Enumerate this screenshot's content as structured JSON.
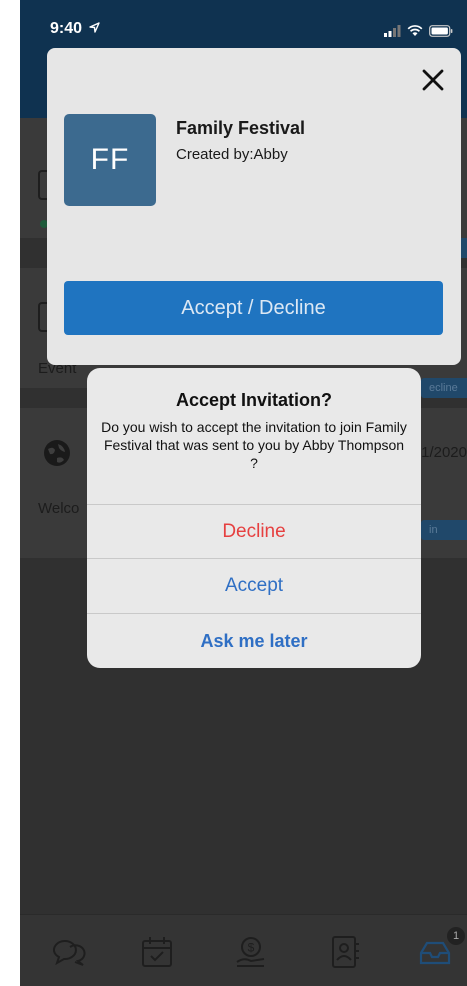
{
  "status_bar": {
    "time": "9:40"
  },
  "background": {
    "row_label_1": "Event",
    "row_label_2": "Welco",
    "row_date": "1/2020",
    "pill_1": "ecline",
    "pill_2": "in"
  },
  "tab_bar": {
    "badge": "1"
  },
  "invite_card": {
    "avatar_initials": "FF",
    "event_title": "Family Festival",
    "created_by": "Created by:Abby",
    "action_label": "Accept / Decline"
  },
  "alert": {
    "title": "Accept Invitation?",
    "message": "Do you wish to accept the invitation to join Family Festival that was sent to you by Abby Thompson ?",
    "decline_label": "Decline",
    "accept_label": "Accept",
    "ask_later_label": "Ask me later"
  },
  "colors": {
    "header": "#0f3250",
    "primary_button": "#1f74c0",
    "avatar": "#3c6a8f",
    "destructive": "#e64040",
    "alert_action": "#2f6fc4"
  }
}
